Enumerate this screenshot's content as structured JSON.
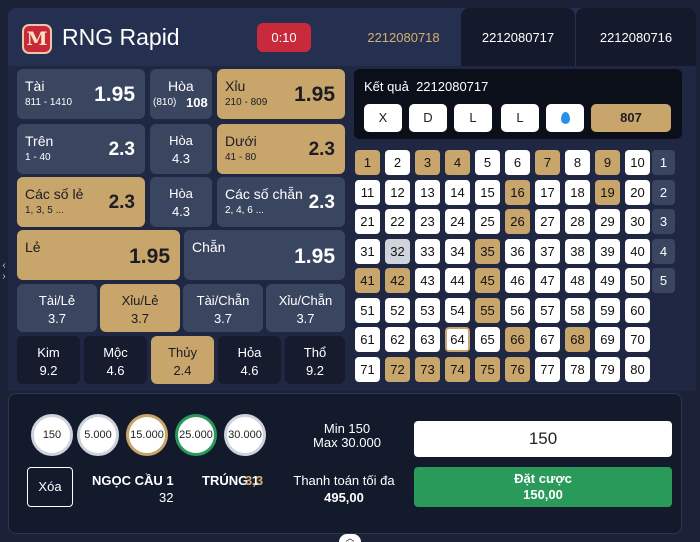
{
  "header": {
    "logo_text": "M",
    "title": "RNG Rapid",
    "timer": "0:10",
    "tabs": [
      "2212080718",
      "2212080717",
      "2212080716"
    ]
  },
  "bets": {
    "tai": {
      "name": "Tài",
      "range": "811 - 1410",
      "odds": "1.95"
    },
    "hoa1": {
      "name": "Hòa",
      "range": "(810)",
      "odds": "108"
    },
    "xiu": {
      "name": "Xỉu",
      "range": "210 - 809",
      "odds": "1.95"
    },
    "tren": {
      "name": "Trên",
      "range": "1 - 40",
      "odds": "2.3"
    },
    "hoa2": {
      "name": "Hòa",
      "odds": "4.3"
    },
    "duoi": {
      "name": "Dưới",
      "range": "41 - 80",
      "odds": "2.3"
    },
    "le_so": {
      "name": "Các số lẻ",
      "range": "1, 3, 5 ...",
      "odds": "2.3"
    },
    "hoa3": {
      "name": "Hòa",
      "odds": "4.3"
    },
    "chan_so": {
      "name": "Các số chẵn",
      "range": "2, 4, 6 ...",
      "odds": "2.3"
    },
    "le": {
      "name": "Lẻ",
      "odds": "1.95"
    },
    "chan": {
      "name": "Chẵn",
      "odds": "1.95"
    },
    "tai_le": {
      "name": "Tài/Lẻ",
      "odds": "3.7"
    },
    "xiu_le": {
      "name": "Xỉu/Lẻ",
      "odds": "3.7"
    },
    "tai_chan": {
      "name": "Tài/Chẵn",
      "odds": "3.7"
    },
    "xiu_chan": {
      "name": "Xỉu/Chẵn",
      "odds": "3.7"
    },
    "kim": {
      "name": "Kim",
      "odds": "9.2"
    },
    "moc": {
      "name": "Mộc",
      "odds": "4.6"
    },
    "thuy": {
      "name": "Thủy",
      "odds": "2.4"
    },
    "hoa_fire": {
      "name": "Hỏa",
      "odds": "4.6"
    },
    "tho": {
      "name": "Thổ",
      "odds": "9.2"
    }
  },
  "result": {
    "label": "Kết quả",
    "round": "2212080717",
    "buttons": [
      "X",
      "D",
      "L",
      "L"
    ],
    "drop_icon": "water-drop-icon",
    "sum": "807"
  },
  "grid": {
    "gold": [
      1,
      3,
      4,
      7,
      9,
      16,
      19,
      26,
      35,
      41,
      42,
      45,
      55,
      66,
      68,
      72,
      73,
      74,
      75,
      76
    ],
    "grey": [
      32
    ],
    "selected": [
      64
    ]
  },
  "row_buttons": [
    "1",
    "2",
    "3",
    "4",
    "5"
  ],
  "bottom": {
    "chips": [
      "150",
      "5.000",
      "15.000",
      "25.000",
      "30.000"
    ],
    "min_label": "Min 150",
    "max_label": "Max 30.000",
    "amount": "150",
    "clear": "Xóa",
    "ngoc_cau_label": "NGỌC CẦU 1",
    "ngoc_cau_value": "32",
    "trung_label": "TRÚNG 1",
    "trung_value": "3,3",
    "pay_label": "Thanh toán tối đa",
    "pay_value": "495,00",
    "place_label": "Đặt cược",
    "place_value": "150,00"
  },
  "colors": {
    "gold": "#c8a56b",
    "red": "#c8293b",
    "green": "#2a9a5a",
    "panel": "#3a4560"
  }
}
